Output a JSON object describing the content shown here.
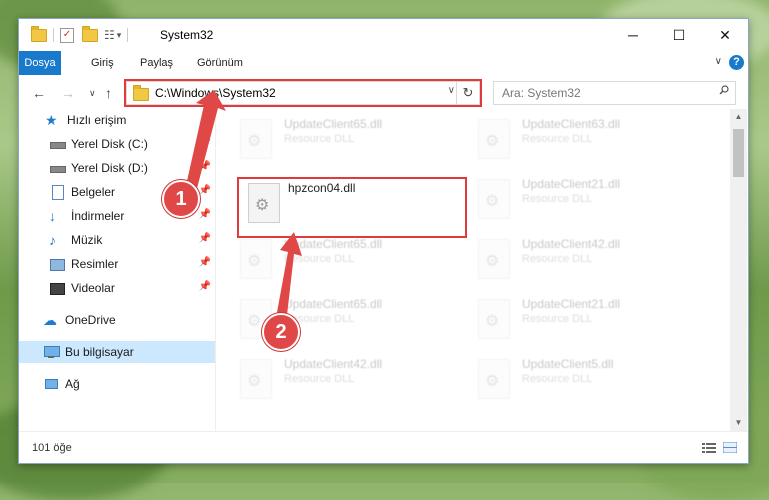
{
  "window": {
    "title": "System32",
    "controls": {
      "minimize": "─",
      "maximize": "☐",
      "close": "✕"
    }
  },
  "ribbon": {
    "tabs": [
      "Dosya",
      "Giriş",
      "Paylaş",
      "Görünüm"
    ],
    "help": "?"
  },
  "navbar": {
    "address": "C:\\Windows\\System32",
    "search_placeholder": "Ara: System32"
  },
  "sidebar": {
    "items": [
      {
        "label": "Hızlı erişim",
        "icon": "star-icon"
      },
      {
        "label": "Yerel Disk (C:)",
        "icon": "drive-icon",
        "pinned": true
      },
      {
        "label": "Yerel Disk (D:)",
        "icon": "drive-icon",
        "pinned": true
      },
      {
        "label": "Belgeler",
        "icon": "documents-icon",
        "pinned": true
      },
      {
        "label": "İndirmeler",
        "icon": "download-icon",
        "pinned": true
      },
      {
        "label": "Müzik",
        "icon": "music-icon",
        "pinned": true
      },
      {
        "label": "Resimler",
        "icon": "pictures-icon",
        "pinned": true
      },
      {
        "label": "Videolar",
        "icon": "video-icon",
        "pinned": true
      },
      {
        "label": "OneDrive",
        "icon": "cloud-icon"
      },
      {
        "label": "Bu bilgisayar",
        "icon": "computer-icon",
        "selected": true
      },
      {
        "label": "Ağ",
        "icon": "network-icon"
      }
    ]
  },
  "files": {
    "highlighted": {
      "name": "hpzcon04.dll",
      "type": ""
    },
    "background": [
      {
        "name": "UpdateClient65.dll",
        "type": "Resource DLL"
      },
      {
        "name": "UpdateClient63.dll",
        "type": "Resource DLL"
      },
      {
        "name": "UpdateClient21.dll",
        "type": "Resource DLL"
      },
      {
        "name": "UpdateClient65.dll",
        "type": "Resource DLL"
      },
      {
        "name": "UpdateClient42.dll",
        "type": "Resource DLL"
      },
      {
        "name": "UpdateClient65.dll",
        "type": "Resource DLL"
      },
      {
        "name": "UpdateClient21.dll",
        "type": "Resource DLL"
      },
      {
        "name": "UpdateClient42.dll",
        "type": "Resource DLL"
      },
      {
        "name": "UpdateClient5.dll",
        "type": "Resource DLL"
      }
    ]
  },
  "status": {
    "item_count": "101 öğe"
  },
  "annotations": {
    "step1": "1",
    "step2": "2",
    "highlight_color": "#e03a3a"
  }
}
